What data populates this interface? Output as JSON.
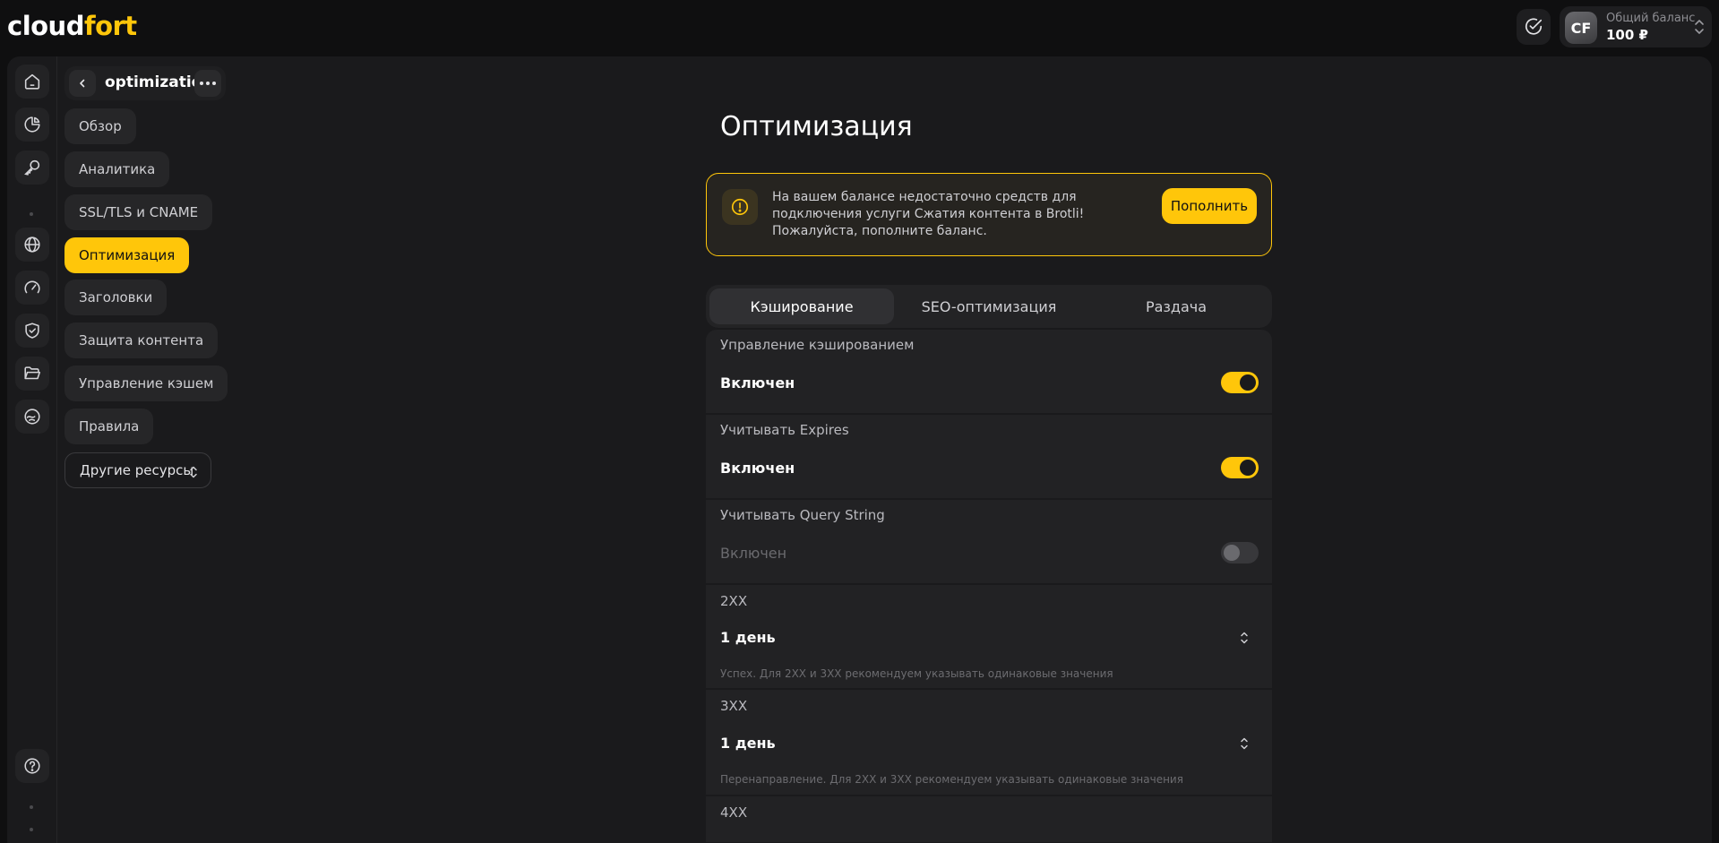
{
  "brand": {
    "part1": "cloud",
    "part2": "fort",
    "accent": "#ffc60a"
  },
  "account": {
    "avatar_initials": "CF",
    "balance_label": "Общий баланс",
    "balance_value": "100 ₽"
  },
  "rail": {
    "icons": [
      "home-icon",
      "analytics-icon",
      "key-icon",
      "globe-icon",
      "speedometer-icon",
      "shield-check-icon",
      "folder-icon",
      "hosting-icon",
      "help-icon"
    ]
  },
  "subnav": {
    "title": "optimization",
    "items": [
      {
        "label": "Обзор",
        "active": false
      },
      {
        "label": "Аналитика",
        "active": false
      },
      {
        "label": "SSL/TLS и CNAME",
        "active": false
      },
      {
        "label": "Оптимизация",
        "active": true
      },
      {
        "label": "Заголовки",
        "active": false
      },
      {
        "label": "Защита контента",
        "active": false
      },
      {
        "label": "Управление кэшем",
        "active": false
      },
      {
        "label": "Правила",
        "active": false
      }
    ],
    "other_resources": "Другие ресурсы"
  },
  "page": {
    "title": "Оптимизация",
    "alert": {
      "text": "На вашем балансе недостаточно средств для подключения услуги Сжатия контента в Brotli! Пожалуйста, пополните баланс.",
      "button": "Пополнить"
    },
    "tabs": [
      {
        "label": "Кэширование",
        "active": true
      },
      {
        "label": "SEO-оптимизация",
        "active": false
      },
      {
        "label": "Раздача",
        "active": false
      }
    ],
    "settings": [
      {
        "label": "Управление кэшированием",
        "value": "Включен",
        "toggle": true
      },
      {
        "label": "Учитывать Expires",
        "value": "Включен",
        "toggle": true
      },
      {
        "label": "Учитывать Query String",
        "value": "Включен",
        "toggle": false
      },
      {
        "label": "2XX",
        "value": "1 день",
        "hint": "Успех. Для 2XX и 3XX рекомендуем указывать одинаковые значения"
      },
      {
        "label": "3XX",
        "value": "1 день",
        "hint": "Перенаправление. Для 2XX и 3XX рекомендуем указывать одинаковые значения"
      },
      {
        "label": "4XX"
      }
    ]
  }
}
